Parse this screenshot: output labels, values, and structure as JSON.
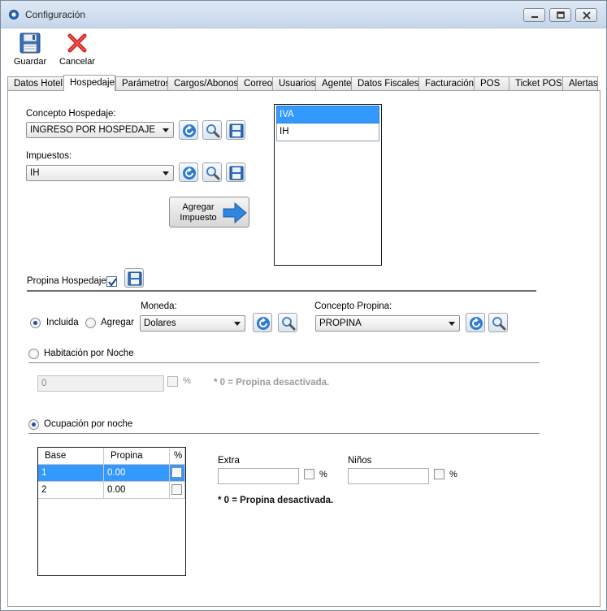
{
  "window": {
    "title": "Configuración"
  },
  "toolbar": {
    "save_label": "Guardar",
    "cancel_label": "Cancelar"
  },
  "tabs": [
    {
      "label": "Datos Hotel"
    },
    {
      "label": "Hospedaje"
    },
    {
      "label": "Parámetros"
    },
    {
      "label": "Cargos/Abonos"
    },
    {
      "label": "Correo"
    },
    {
      "label": "Usuarios"
    },
    {
      "label": "Agente"
    },
    {
      "label": "Datos Fiscales"
    },
    {
      "label": "Facturación"
    },
    {
      "label": "POS"
    },
    {
      "label": "Ticket POS"
    },
    {
      "label": "Alertas"
    }
  ],
  "active_tab": "Hospedaje",
  "hospedaje": {
    "concepto_label": "Concepto Hospedaje:",
    "concepto_value": "INGRESO POR HOSPEDAJE",
    "impuestos_label": "Impuestos:",
    "impuestos_value": "IH",
    "agregar_line1": "Agregar",
    "agregar_line2": "Impuesto",
    "taxes_list": [
      "IVA",
      "IH"
    ],
    "taxes_selected": "IVA"
  },
  "propina": {
    "label": "Propina Hospedaje",
    "enabled": true,
    "incluida_label": "Incluida",
    "agregar_label": "Agregar",
    "mode": "Incluida",
    "moneda_label": "Moneda:",
    "moneda_value": "Dolares",
    "concepto_label": "Concepto Propina:",
    "concepto_value": "PROPINA",
    "habitacion_label": "Habitación por Noche",
    "habitacion_value": "0",
    "habitacion_pct": "%",
    "habitacion_note": "* 0 = Propina desactivada.",
    "ocupacion_label": "Ocupación por noche",
    "grid_headers": [
      "Base",
      "Propina",
      "%"
    ],
    "grid_rows": [
      {
        "base": "1",
        "propina": "0.00",
        "pct": false
      },
      {
        "base": "2",
        "propina": "0.00",
        "pct": false
      }
    ],
    "extra_label": "Extra",
    "extra_value": "",
    "extra_pct": "%",
    "ninos_label": "Niños",
    "ninos_value": "",
    "ninos_pct": "%",
    "ocupacion_note": "* 0 = Propina desactivada."
  },
  "colors": {
    "selection": "#3399ff",
    "accent_blue": "#2f7bd3",
    "cancel_red": "#d42020"
  }
}
